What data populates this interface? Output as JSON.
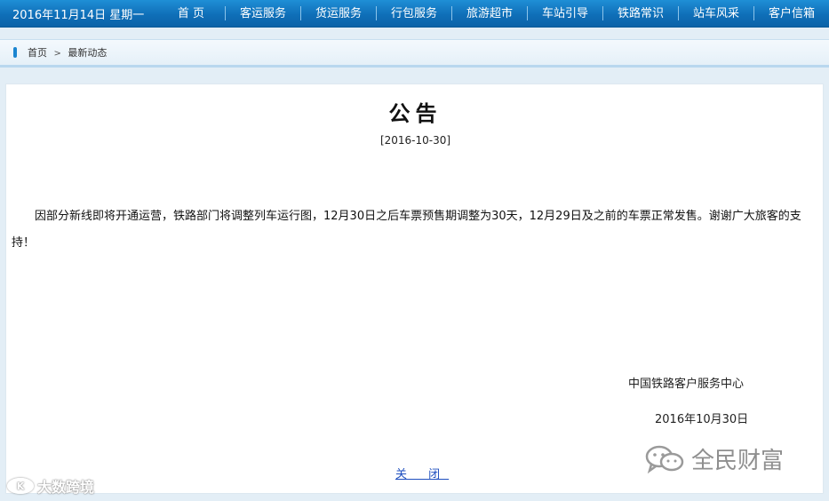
{
  "header": {
    "date": "2016年11月14日 星期一",
    "nav": [
      "首 页",
      "客运服务",
      "货运服务",
      "行包服务",
      "旅游超市",
      "车站引导",
      "铁路常识",
      "站车风采",
      "客户信箱"
    ]
  },
  "breadcrumb": {
    "home": "首页",
    "separator": ">",
    "current": "最新动态"
  },
  "notice": {
    "title": "公告",
    "date": "[2016-10-30]",
    "body": "因部分新线即将开通运营，铁路部门将调整列车运行图，12月30日之后车票预售期调整为30天，12月29日及之前的车票正常发售。谢谢广大旅客的支持！",
    "signature_org": "中国铁路客户服务中心",
    "signature_date": "2016年10月30日",
    "close_label": "关 闭"
  },
  "watermarks": {
    "left_text": "大数跨境",
    "left_mark": "K",
    "right_text": "全民财富",
    "right_icon": "wechat-icon"
  },
  "colors": {
    "nav_bg": "#0f6fb8",
    "accent": "#1a85d0",
    "link": "#1f4fbf"
  }
}
